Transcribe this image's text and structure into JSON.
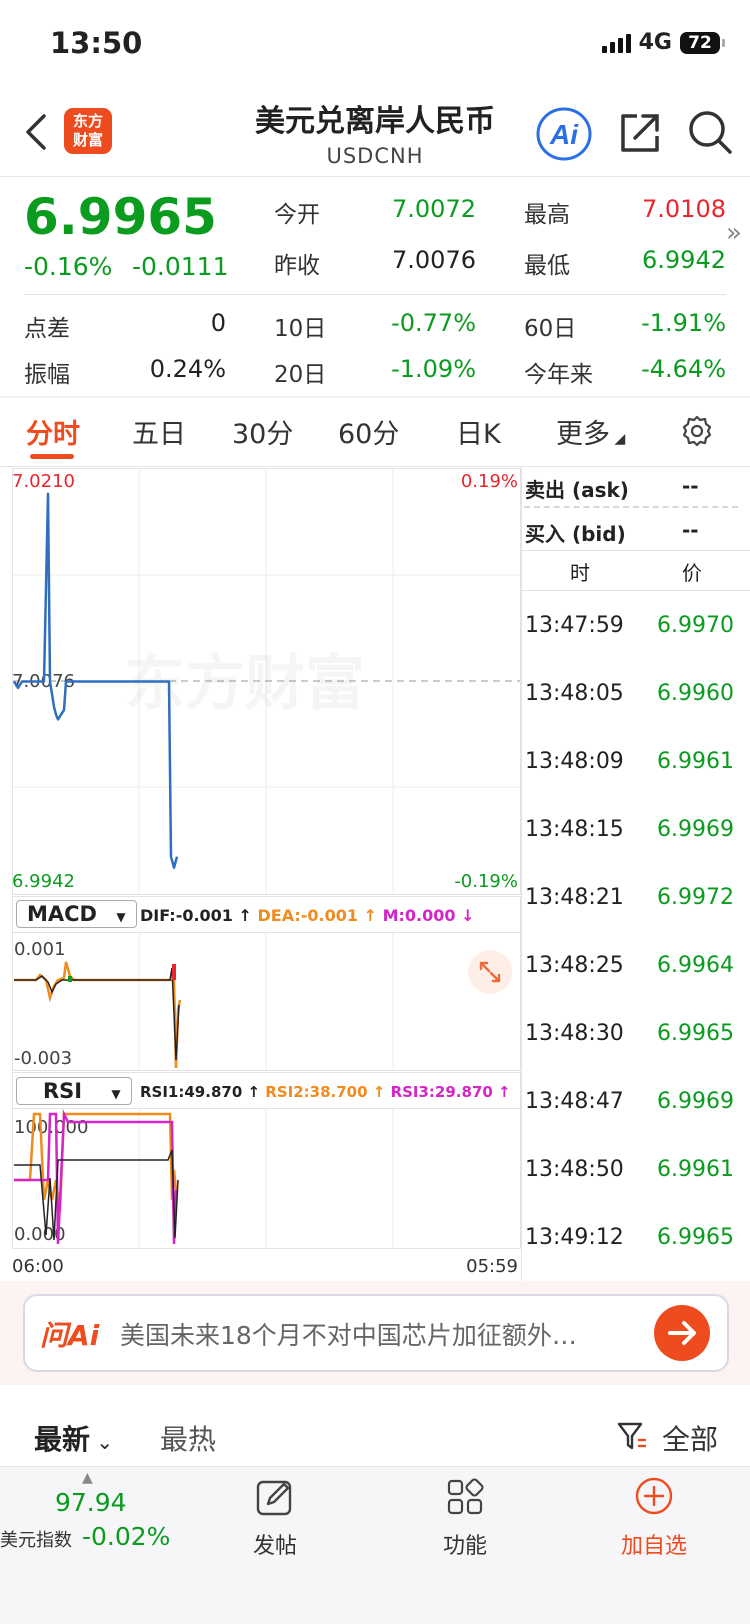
{
  "status": {
    "time": "13:50",
    "network": "4G",
    "battery": "72"
  },
  "header": {
    "title": "美元兑离岸人民币",
    "subtitle": "USDCNH",
    "logo_line1": "东方",
    "logo_line2": "财富",
    "ai_label": "Ai"
  },
  "quote": {
    "price": "6.9965",
    "change_pct": "-0.16%",
    "change_abs": "-0.0111",
    "open_label": "今开",
    "open": "7.0072",
    "high_label": "最高",
    "high": "7.0108",
    "prev_close_label": "昨收",
    "prev_close": "7.0076",
    "low_label": "最低",
    "low": "6.9942",
    "spread_label": "点差",
    "spread": "0",
    "d10_label": "10日",
    "d10": "-0.77%",
    "d60_label": "60日",
    "d60": "-1.91%",
    "amplitude_label": "振幅",
    "amplitude": "0.24%",
    "d20_label": "20日",
    "d20": "-1.09%",
    "ytd_label": "今年来",
    "ytd": "-4.64%"
  },
  "tabs": [
    "分时",
    "五日",
    "30分",
    "60分",
    "日K",
    "更多"
  ],
  "chart": {
    "watermark": "东方财富",
    "y_top": "7.0210",
    "y_mid": "7.0076",
    "y_bottom": "6.9942",
    "pct_top": "0.19%",
    "pct_bottom": "-0.19%",
    "x_start": "06:00",
    "x_end": "05:59",
    "macd": {
      "name": "MACD",
      "dif": "DIF:-0.001",
      "dea": "DEA:-0.001",
      "m": "M:0.000",
      "top": "0.001",
      "bottom": "-0.003"
    },
    "rsi": {
      "name": "RSI",
      "rsi1": "RSI1:49.870",
      "rsi2": "RSI2:38.700",
      "rsi3": "RSI3:29.870",
      "top": "100.000",
      "bottom": "0.000"
    }
  },
  "chart_data": {
    "type": "line",
    "title": "",
    "x_range": [
      "06:00",
      "05:59"
    ],
    "ylim": [
      6.9942,
      7.021
    ],
    "prev_close": 7.0076,
    "series": [
      {
        "values": [
          7.0076,
          7.0072,
          7.0076,
          7.0076,
          7.0195,
          7.0076,
          7.0068,
          7.006,
          7.0055,
          7.0052,
          7.0058,
          7.0076,
          7.0076,
          7.0076,
          7.0076,
          7.0076,
          6.9965,
          6.9958,
          6.9965
        ]
      }
    ]
  },
  "right_panel": {
    "ask_label": "卖出 (ask)",
    "ask_value": "--",
    "bid_label": "买入 (bid)",
    "bid_value": "--",
    "col_time": "时",
    "col_price": "价",
    "ticks": [
      {
        "time": "13:47:59",
        "price": "6.9970"
      },
      {
        "time": "13:48:05",
        "price": "6.9960"
      },
      {
        "time": "13:48:09",
        "price": "6.9961"
      },
      {
        "time": "13:48:15",
        "price": "6.9969"
      },
      {
        "time": "13:48:21",
        "price": "6.9972"
      },
      {
        "time": "13:48:25",
        "price": "6.9964"
      },
      {
        "time": "13:48:30",
        "price": "6.9965"
      },
      {
        "time": "13:48:47",
        "price": "6.9969"
      },
      {
        "time": "13:48:50",
        "price": "6.9961"
      },
      {
        "time": "13:49:12",
        "price": "6.9965"
      }
    ]
  },
  "ask_ai": {
    "logo": "问Ai",
    "text": "美国未来18个月不对中国芯片加征额外…"
  },
  "feed": {
    "latest": "最新",
    "hot": "最热",
    "filter_all": "全部"
  },
  "bottom_nav": {
    "index_value": "97.94",
    "index_name": "美元指数",
    "index_change": "-0.02%",
    "post": "发帖",
    "features": "功能",
    "add_watch": "加自选"
  },
  "colors": {
    "accent": "#ee4c1f",
    "up": "#e8262d",
    "down": "#0a9b1f",
    "line": "#2f6fc0"
  }
}
